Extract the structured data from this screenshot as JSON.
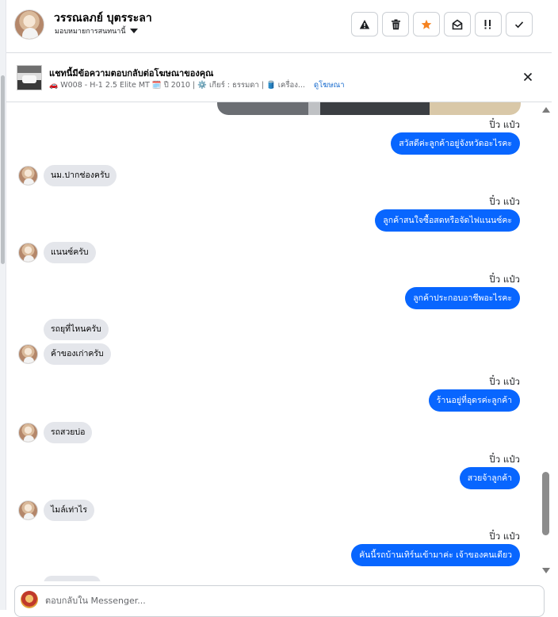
{
  "header": {
    "name": "วรรณลภย์ บุตรระลา",
    "assign_label": "มอบหมายการสนทนานี้",
    "actions": [
      {
        "icon": "warning-icon",
        "color": "#1c1e21"
      },
      {
        "icon": "trash-icon",
        "color": "#1c1e21"
      },
      {
        "icon": "star-icon",
        "color": "#f5821f"
      },
      {
        "icon": "mark-unread-icon",
        "color": "#1c1e21"
      },
      {
        "icon": "follow-up-icon",
        "color": "#1c1e21"
      },
      {
        "icon": "checkmark-icon",
        "color": "#1c1e21"
      }
    ]
  },
  "ad": {
    "title": "แชทนี้มีข้อความตอบกลับต่อโฆษณาของคุณ",
    "details": "W008 - H-1 2.5 Elite MT 🗓️ ปี 2010 | ⚙️ เกียร์ : ธรรมดา | 🛢️ เครื่อง...",
    "car_icon": "🚗",
    "view_ad_link": "ดูโฆษณา"
  },
  "conversation": {
    "sender_label": "ปิ๋ว แป๋ว",
    "messages": [
      {
        "dir": "out",
        "text": "สวัสดีค่ะลูกค้าอยู่จังหวัดอะไรคะ"
      },
      {
        "dir": "in",
        "text": "นม.ปากช่องครับ"
      },
      {
        "dir": "out",
        "text": "ลูกค้าสนใจซื้อสดหรือจัดไฟแนนซ์คะ"
      },
      {
        "dir": "in",
        "text": "แนนซ์ครับ"
      },
      {
        "dir": "out",
        "text": "ลูกค้าประกอบอาชีพอะไรคะ"
      },
      {
        "dir": "in",
        "text": "รถยุที่ไหนครับ"
      },
      {
        "dir": "in",
        "text": "ค้าของเก่าครับ"
      },
      {
        "dir": "out",
        "text": "ร้านอยู่ที่อุดรค่ะลูกค้า"
      },
      {
        "dir": "in",
        "text": "รถสวยบ่อ"
      },
      {
        "dir": "out",
        "text": "สวยจ้าลูกค้า"
      },
      {
        "dir": "in",
        "text": "ไมล์เท่าไร"
      },
      {
        "dir": "out",
        "text": "คันนี้รถบ้านเทิร์นเข้ามาค่ะ  เจ้าของคนเดียว"
      }
    ]
  },
  "composer": {
    "placeholder": "ตอบกลับใน Messenger..."
  },
  "colors": {
    "outgoing_bubble": "#0866ff",
    "incoming_bubble": "#e4e6eb",
    "link": "#1a6dcf",
    "star": "#f5821f"
  }
}
